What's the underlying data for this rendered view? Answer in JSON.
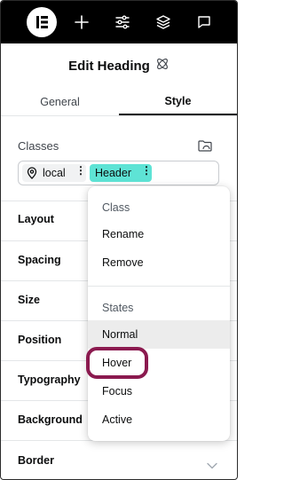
{
  "toolbar": {
    "icons": [
      "elementor-logo-icon",
      "plus-icon",
      "sliders-icon",
      "layers-icon",
      "chat-icon"
    ]
  },
  "panel": {
    "title": "Edit Heading",
    "title_icon": "atom-icon"
  },
  "tabs": [
    {
      "label": "General",
      "active": false
    },
    {
      "label": "Style",
      "active": true
    }
  ],
  "classes": {
    "label": "Classes",
    "chips": [
      {
        "label": "local",
        "icon": "location-pin-icon",
        "color": "#f1f2f3"
      },
      {
        "label": "Header",
        "color": "#5ee3d5"
      }
    ]
  },
  "sections": [
    {
      "label": "Layout"
    },
    {
      "label": "Spacing"
    },
    {
      "label": "Size"
    },
    {
      "label": "Position"
    },
    {
      "label": "Typography"
    },
    {
      "label": "Background"
    },
    {
      "label": "Border"
    }
  ],
  "menu": {
    "class_group_title": "Class",
    "class_items": [
      "Rename",
      "Remove"
    ],
    "states_group_title": "States",
    "state_items": [
      "Normal",
      "Hover",
      "Focus",
      "Active"
    ],
    "highlighted_item": "Normal",
    "circled_item": "Hover",
    "circle_color": "#8b1a4f"
  }
}
